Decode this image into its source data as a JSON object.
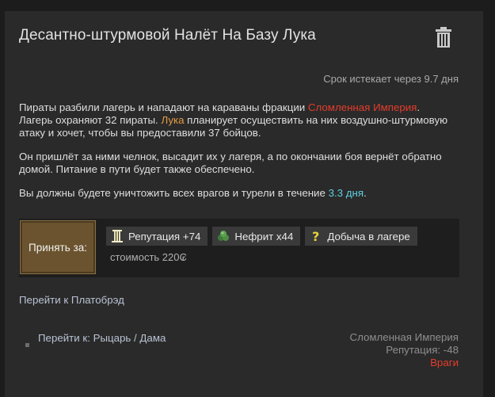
{
  "quest": {
    "title": "Десантно-штурмовой Налёт На Базу Лука",
    "expires": "Срок истекает через 9.7 дня",
    "p1": {
      "a": "Пираты разбили лагерь и нападают на караваны фракции ",
      "faction": "Сломленная Империя",
      "b": ".",
      "c": "Лагерь охраняют 32 пираты. ",
      "person": "Лука",
      "d": " планирует осуществить на них воздушно-штурмовую атаку и хочет, чтобы вы предоставили 37 бойцов."
    },
    "p2": "Он пришлёт за ними челнок, высадит их у лагеря, а по окончании боя вернёт обратно домой. Питание в пути будет также обеспечено.",
    "p3": {
      "a": "Вы должны будете уничтожить всех врагов и турели в течение ",
      "time": "3.3 дня",
      "b": "."
    }
  },
  "reward": {
    "accept_label": "Принять за:",
    "items": [
      {
        "label": "Репутация +74",
        "icon": "column-icon"
      },
      {
        "label": "Нефрит x44",
        "icon": "jade-icon"
      },
      {
        "label": "Добыча в лагере",
        "icon": "question-icon"
      }
    ],
    "cost": "стоимость 220₢"
  },
  "links": {
    "goto_platform": "Перейти к Платобрэд",
    "goto_knight": "Перейти к: Рыцарь / Дама"
  },
  "faction": {
    "name": "Сломленная Империя",
    "reputation": "Репутация: -48",
    "relation": "Враги"
  },
  "colors": {
    "faction_red": "#e43c2c",
    "person_orange": "#e59b45",
    "time_cyan": "#5fd0e0"
  }
}
